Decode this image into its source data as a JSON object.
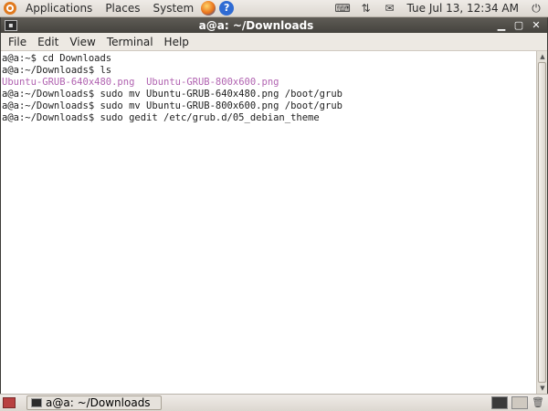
{
  "top_panel": {
    "menus": [
      "Applications",
      "Places",
      "System"
    ],
    "clock": "Tue Jul 13, 12:34 AM",
    "icons": {
      "logo": "ubuntu-logo-icon",
      "browser": "firefox-icon",
      "help": "help-icon",
      "help_glyph": "?",
      "tray": [
        "keyboard-icon",
        "network-icon",
        "mail-icon"
      ],
      "power": "power-icon"
    }
  },
  "window": {
    "title": "a@a: ~/Downloads",
    "menubar": [
      "File",
      "Edit",
      "View",
      "Terminal",
      "Help"
    ]
  },
  "terminal": {
    "lines": [
      {
        "type": "cmd",
        "text": "a@a:~$ cd Downloads"
      },
      {
        "type": "cmd",
        "text": "a@a:~/Downloads$ ls"
      },
      {
        "type": "files",
        "files": [
          "Ubuntu-GRUB-640x480.png",
          "Ubuntu-GRUB-800x600.png"
        ]
      },
      {
        "type": "cmd",
        "text": "a@a:~/Downloads$ sudo mv Ubuntu-GRUB-640x480.png /boot/grub"
      },
      {
        "type": "cmd",
        "text": "a@a:~/Downloads$ sudo mv Ubuntu-GRUB-800x600.png /boot/grub"
      },
      {
        "type": "cmd",
        "text": "a@a:~/Downloads$ sudo gedit /etc/grub.d/05_debian_theme"
      }
    ],
    "file_color": "#b163b1"
  },
  "bottom_panel": {
    "task_label": "a@a: ~/Downloads"
  }
}
